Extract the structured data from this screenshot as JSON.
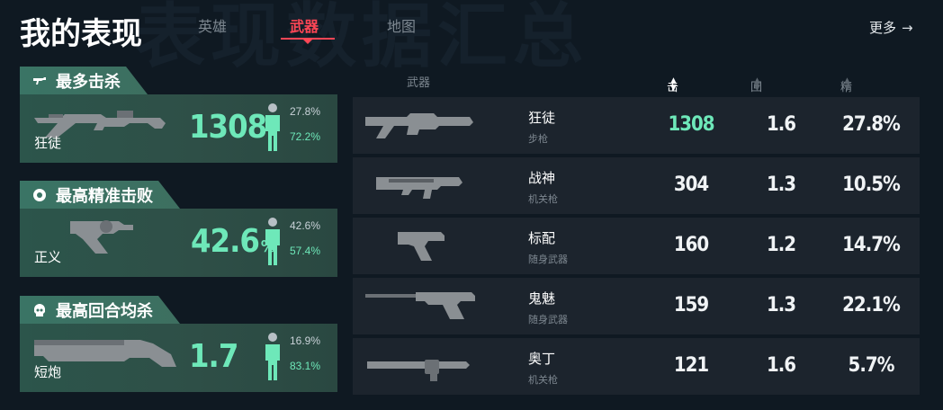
{
  "header": {
    "title": "我的表现",
    "watermark": "表现数据汇总",
    "tabs": [
      "英雄",
      "武器",
      "地图"
    ],
    "active_tab": "武器",
    "more_label": "更多",
    "more_arrow": "→"
  },
  "colors": {
    "accent": "#ff4655",
    "highlight": "#6ee8b9",
    "card_green": "#2c554b",
    "row_bg": "#1c242d"
  },
  "cards": [
    {
      "title": "最多击杀",
      "icon": "gun-icon",
      "weapon": "狂徒",
      "value": "1308",
      "unit": "",
      "pct_top": "27.8%",
      "pct_bottom": "72.2%",
      "lower_share": 0.722
    },
    {
      "title": "最高精准击败",
      "icon": "headshot-icon",
      "weapon": "正义",
      "value": "42.6",
      "unit": "%",
      "pct_top": "42.6%",
      "pct_bottom": "57.4%",
      "lower_share": 0.574
    },
    {
      "title": "最高回合均杀",
      "icon": "skull-icon",
      "weapon": "短炮",
      "value": "1.7",
      "unit": "",
      "pct_top": "16.9%",
      "pct_bottom": "83.1%",
      "lower_share": 0.831
    }
  ],
  "table": {
    "columns": {
      "weapon": "武器",
      "kills": "击杀数",
      "avg": "回合均杀",
      "precision": "精准击败"
    },
    "sort_active": "▲▼",
    "rows": [
      {
        "name": "狂徒",
        "type": "步枪",
        "kills": "1308",
        "avg": "1.6",
        "precision": "27.8%"
      },
      {
        "name": "战神",
        "type": "机关枪",
        "kills": "304",
        "avg": "1.3",
        "precision": "10.5%"
      },
      {
        "name": "标配",
        "type": "随身武器",
        "kills": "160",
        "avg": "1.2",
        "precision": "14.7%"
      },
      {
        "name": "鬼魅",
        "type": "随身武器",
        "kills": "159",
        "avg": "1.3",
        "precision": "22.1%"
      },
      {
        "name": "奥丁",
        "type": "机关枪",
        "kills": "121",
        "avg": "1.6",
        "precision": "5.7%"
      }
    ]
  }
}
